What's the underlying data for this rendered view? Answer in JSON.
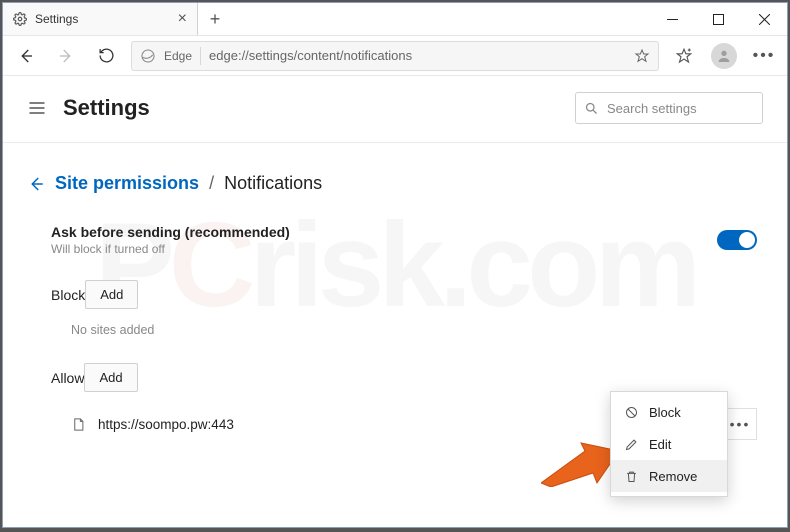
{
  "window": {
    "tab_title": "Settings"
  },
  "nav": {
    "edge_label": "Edge",
    "url": "edge://settings/content/notifications"
  },
  "header": {
    "title": "Settings",
    "search_placeholder": "Search settings"
  },
  "breadcrumb": {
    "parent": "Site permissions",
    "sep": "/",
    "current": "Notifications"
  },
  "ask": {
    "label": "Ask before sending (recommended)",
    "sub": "Will block if turned off",
    "toggle_on": true
  },
  "block": {
    "label": "Block",
    "add": "Add",
    "empty": "No sites added"
  },
  "allow": {
    "label": "Allow",
    "add": "Add",
    "sites": [
      {
        "url": "https://soompo.pw:443"
      }
    ]
  },
  "context_menu": {
    "block": "Block",
    "edit": "Edit",
    "remove": "Remove"
  }
}
